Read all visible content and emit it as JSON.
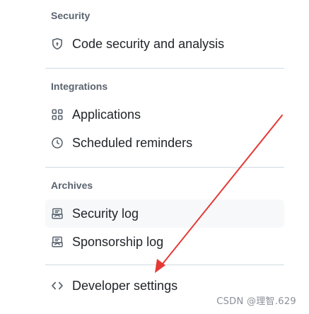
{
  "sections": {
    "security": {
      "heading": "Security",
      "items": [
        {
          "label": "Code security and analysis",
          "icon": "shield-icon"
        }
      ]
    },
    "integrations": {
      "heading": "Integrations",
      "items": [
        {
          "label": "Applications",
          "icon": "apps-grid-icon"
        },
        {
          "label": "Scheduled reminders",
          "icon": "clock-icon"
        }
      ]
    },
    "archives": {
      "heading": "Archives",
      "items": [
        {
          "label": "Security log",
          "icon": "log-icon",
          "selected": true
        },
        {
          "label": "Sponsorship log",
          "icon": "log-icon"
        }
      ]
    },
    "developer": {
      "items": [
        {
          "label": "Developer settings",
          "icon": "code-icon"
        }
      ]
    }
  },
  "watermark": "CSDN @理智.629",
  "annotation": {
    "type": "red-arrow",
    "color": "#e53935"
  }
}
